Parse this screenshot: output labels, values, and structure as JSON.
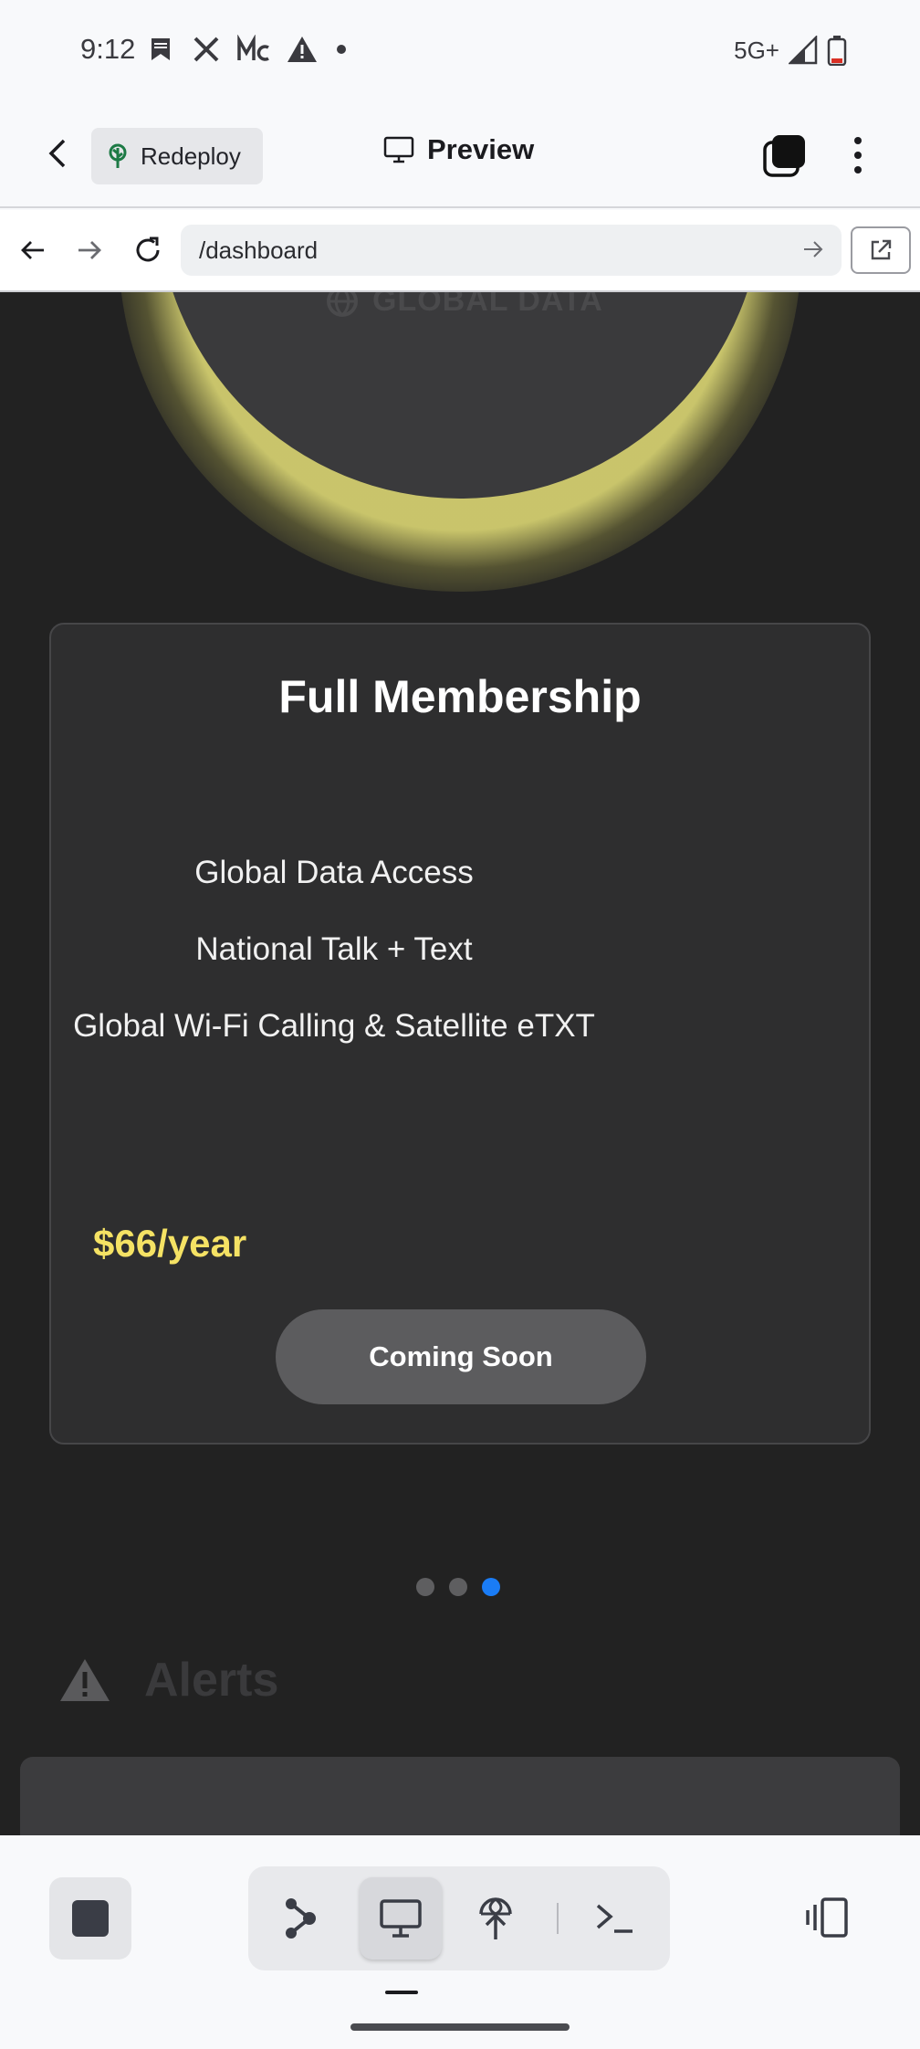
{
  "status_bar": {
    "time": "9:12",
    "network": "5G+",
    "icons": [
      "bookmark-notification-icon",
      "x-app-icon",
      "mc-app-icon",
      "warning-icon",
      "dot-icon",
      "signal-icon",
      "battery-low-icon"
    ]
  },
  "app_toolbar": {
    "redeploy_label": "Redeploy",
    "preview_label": "Preview"
  },
  "browser": {
    "url": "/dashboard"
  },
  "page": {
    "hero_label": "GLOBAL DATA",
    "plan": {
      "title": "Full Membership",
      "features": [
        "Global Data Access",
        "National Talk + Text",
        "Global Wi-Fi Calling & Satellite eTXT"
      ],
      "price": "$66/year",
      "button_label": "Coming Soon"
    },
    "carousel": {
      "count": 3,
      "active_index": 2
    },
    "alerts_label": "Alerts"
  },
  "colors": {
    "accent_yellow": "#f5e264",
    "active_dot_blue": "#1a7cf5",
    "page_background": "#222222",
    "card_background": "#2e2e2f"
  }
}
